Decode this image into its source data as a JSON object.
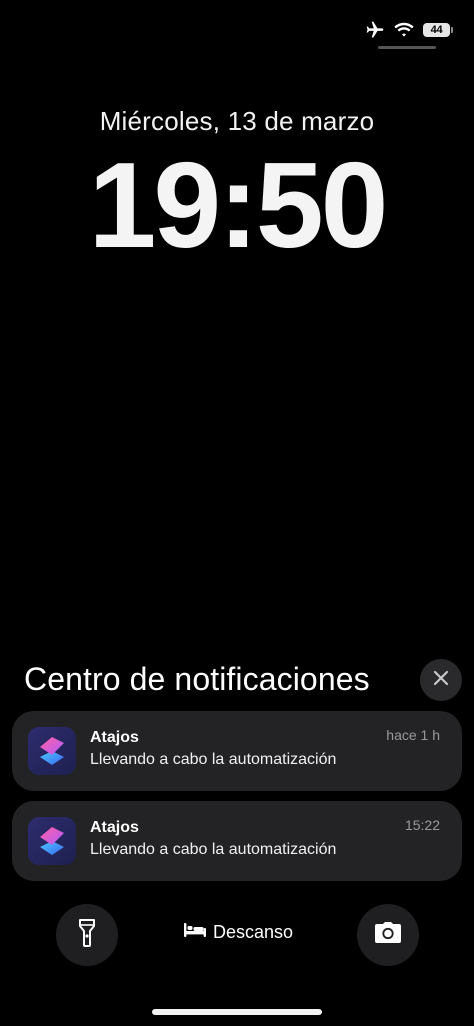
{
  "status_bar": {
    "icons": [
      "airplane-icon",
      "wifi-icon"
    ],
    "battery_level": "44"
  },
  "lock_screen": {
    "date": "Miércoles, 13 de marzo",
    "time": "19:50"
  },
  "notification_center": {
    "title": "Centro de notificaciones",
    "close_icon": "close-icon",
    "notifications": [
      {
        "app": "Atajos",
        "icon": "shortcuts-app-icon",
        "message": "Llevando a cabo la automatización",
        "time": "hace 1 h"
      },
      {
        "app": "Atajos",
        "icon": "shortcuts-app-icon",
        "message": "Llevando a cabo la automatización",
        "time": "15:22"
      }
    ]
  },
  "bottom_bar": {
    "flashlight_icon": "flashlight-icon",
    "focus_mode_icon": "bed-icon",
    "focus_mode_label": "Descanso",
    "camera_icon": "camera-icon"
  },
  "colors": {
    "background": "#000000",
    "card": "#232325",
    "secondary_text": "#9a9a9e",
    "button_bg": "#1f1f21"
  }
}
